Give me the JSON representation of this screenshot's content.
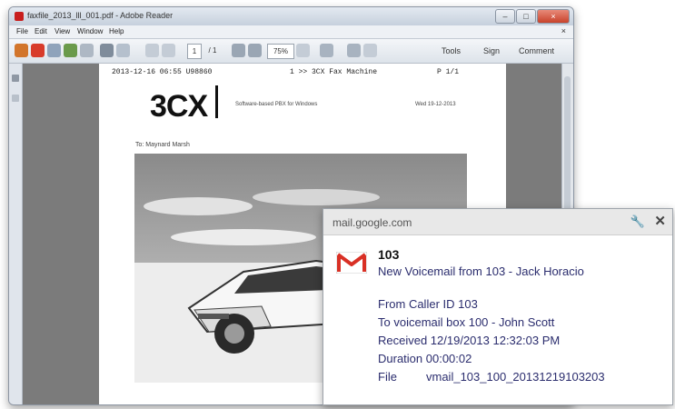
{
  "window": {
    "title": "faxfile_2013_lll_001.pdf - Adobe Reader",
    "menu": [
      "File",
      "Edit",
      "View",
      "Window",
      "Help"
    ],
    "close_glyph": "×",
    "controls": {
      "minimize": "–",
      "maximize": "□",
      "close": "×"
    }
  },
  "toolbar": {
    "page_number": "1",
    "page_total": "/ 1",
    "zoom": "75%",
    "links": [
      "Tools",
      "Sign",
      "Comment"
    ]
  },
  "document": {
    "fax_header": {
      "left": "2013-12-16 06:55 U98860",
      "middle": "1 >> 3CX Fax Machine",
      "right": "P 1/1"
    },
    "logo": "3CX",
    "company_line": "Software-based PBX for Windows",
    "date_line": "Wed 19-12-2013",
    "to_line": "To: Maynard Marsh"
  },
  "notification": {
    "domain": "mail.google.com",
    "sender": "103",
    "subject": "New Voicemail from 103 - Jack Horacio",
    "lines": [
      {
        "label": "From Caller ID 103",
        "value": ""
      },
      {
        "label": "To voicemail box 100 - John Scott",
        "value": ""
      },
      {
        "label": "Received 12/19/2013 12:32:03 PM",
        "value": ""
      },
      {
        "label": "Duration 00:00:02",
        "value": ""
      },
      {
        "label": "File",
        "value": "vmail_103_100_20131219103203"
      }
    ],
    "icons": {
      "settings": "wrench-icon",
      "close": "close-icon",
      "app": "gmail-icon"
    },
    "colors": {
      "text": "#2b2d6e",
      "gmail_red": "#d93025"
    }
  }
}
